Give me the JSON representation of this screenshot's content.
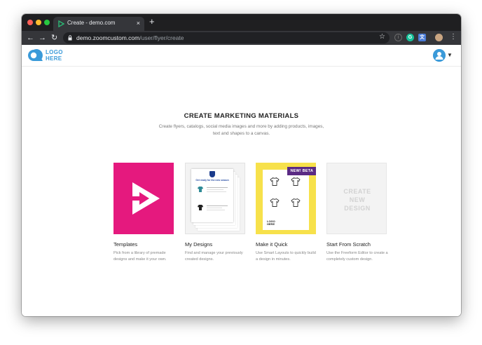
{
  "browser": {
    "tab_title": "Create - demo.com",
    "url_host": "demo.zoomcustom.com",
    "url_path": "/user/flyer/create",
    "new_tab_label": "+",
    "close_label": "×"
  },
  "app": {
    "logo_line1": "LOGO",
    "logo_line2": "HERE",
    "accent": "#3a9ad9"
  },
  "main": {
    "heading": "CREATE MARKETING MATERIALS",
    "subtitle": "Create flyers, catalogs, social media images and more by adding products, images, text and shapes to a canvas."
  },
  "cards": [
    {
      "title": "Templates",
      "desc": "Pick from a library of premade designs and make it your own.",
      "color": "#e5197e"
    },
    {
      "title": "My Designs",
      "desc": "Find and manage your previously created designs.",
      "preview_text": "Get ready for the new season"
    },
    {
      "title": "Make it Quick",
      "desc": "Use Smart Layouts to quickly build a design in minutes.",
      "badge": "NEW! BETA",
      "color": "#f7e14b"
    },
    {
      "title": "Start From Scratch",
      "desc": "Use the Freeform Editor to create a completely custom design.",
      "thumb_line1": "CREATE",
      "thumb_line2": "NEW",
      "thumb_line3": "DESIGN"
    }
  ]
}
